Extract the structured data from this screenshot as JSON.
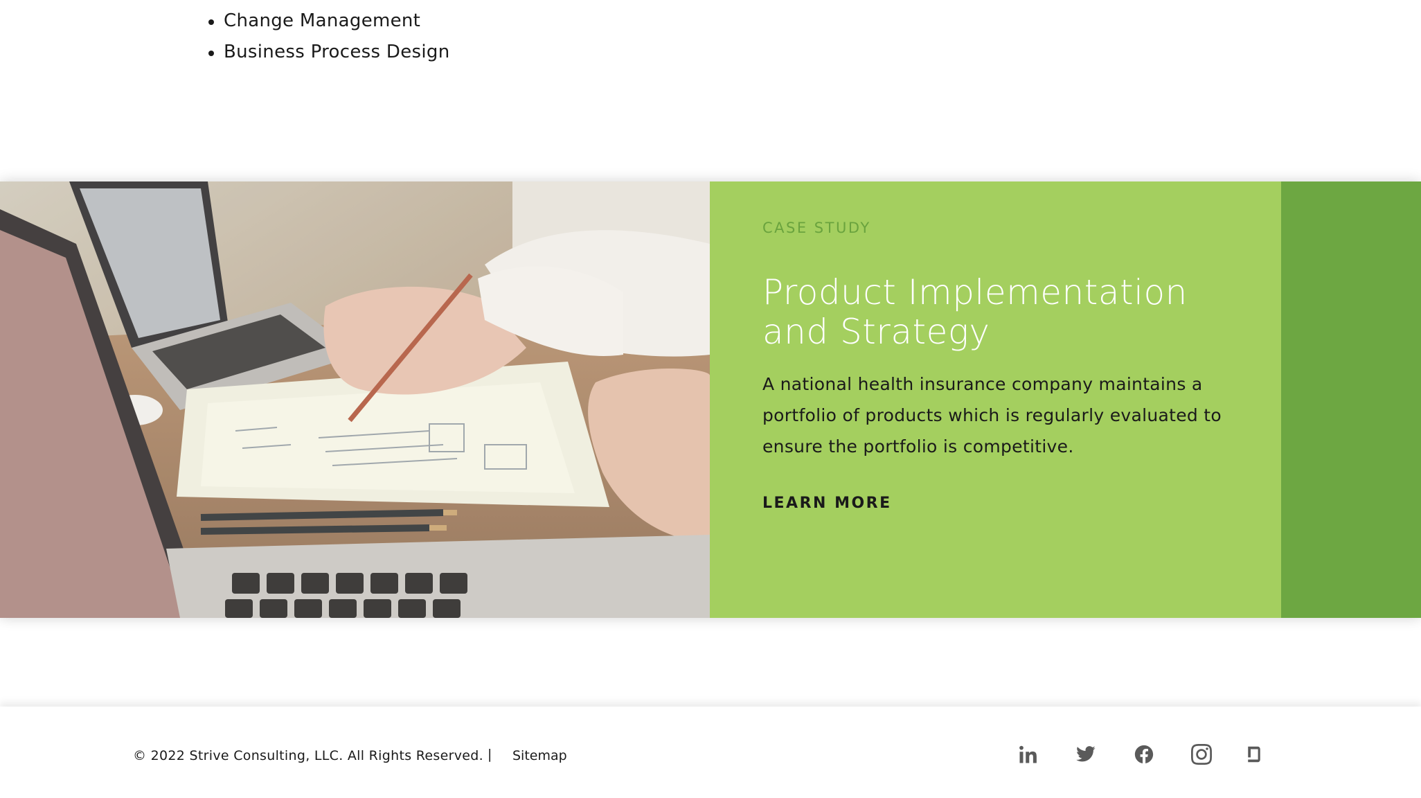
{
  "services": {
    "items": [
      "Change Management",
      "Business Process Design"
    ]
  },
  "case_study": {
    "eyebrow": "CASE STUDY",
    "title_line1": "Product Implementation",
    "title_line2": "and Strategy",
    "body": "A national health insurance company maintains a portfolio of products which is regularly evaluated to ensure the portfolio is competitive.",
    "link_label": "LEARN MORE",
    "panel_color": "#a4cf5f",
    "accent_color": "#6da742"
  },
  "footer": {
    "copyright": "© 2022 Strive Consulting, LLC. All Rights Reserved.",
    "separator": "|",
    "sitemap_label": "Sitemap",
    "social_icons": [
      "linkedin-icon",
      "twitter-icon",
      "facebook-icon",
      "instagram-icon",
      "glassdoor-icon"
    ]
  }
}
